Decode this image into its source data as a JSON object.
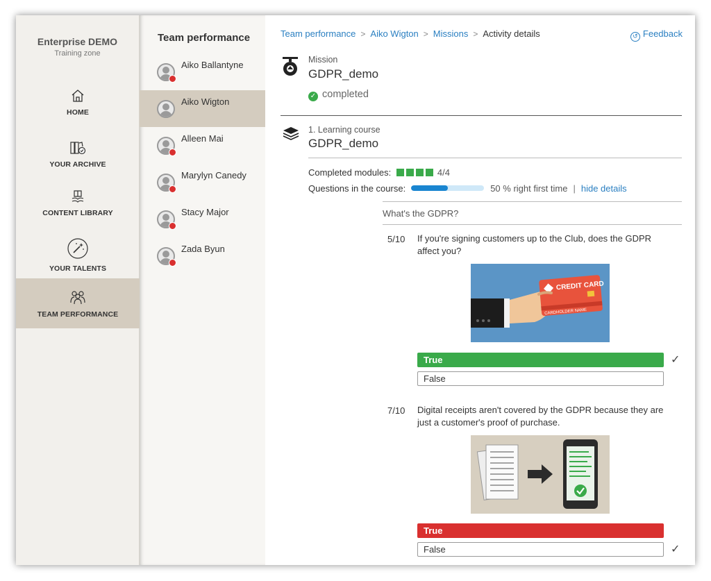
{
  "brand": {
    "title": "Enterprise DEMO",
    "subtitle": "Training zone"
  },
  "nav": [
    {
      "label": "HOME",
      "icon": "home-icon"
    },
    {
      "label": "YOUR ARCHIVE",
      "icon": "archive-icon"
    },
    {
      "label": "CONTENT LIBRARY",
      "icon": "library-icon"
    },
    {
      "label": "YOUR TALENTS",
      "icon": "talents-icon"
    },
    {
      "label": "TEAM PERFORMANCE",
      "icon": "team-icon",
      "active": true
    }
  ],
  "team": {
    "title": "Team performance",
    "members": [
      {
        "name": "Aiko Ballantyne"
      },
      {
        "name": "Aiko Wigton",
        "active": true
      },
      {
        "name": "Alleen Mai"
      },
      {
        "name": "Marylyn Canedy"
      },
      {
        "name": "Stacy Major"
      },
      {
        "name": "Zada Byun"
      }
    ]
  },
  "breadcrumb": {
    "items": [
      "Team performance",
      "Aiko Wigton",
      "Missions"
    ],
    "current": "Activity details"
  },
  "feedback_label": "Feedback",
  "mission": {
    "type": "Mission",
    "name": "GDPR_demo",
    "status": "completed"
  },
  "course": {
    "type": "1. Learning course",
    "name": "GDPR_demo",
    "modules_label": "Completed modules:",
    "modules_done": 4,
    "modules_total": 4,
    "modules_count": "4/4",
    "questions_label": "Questions in the course:",
    "questions_progress": 0.5,
    "questions_text": "50 % right first time",
    "hide_details": "hide details"
  },
  "section": {
    "title": "What's the GDPR?",
    "questions": [
      {
        "num": "5/10",
        "text": "If you're signing customers up to the          Club, does the GDPR affect you?",
        "image": "credit-card-illustration",
        "image_text": "CREDIT CARD",
        "image_subtext": "CARDHOLDER NAME",
        "answers": [
          {
            "label": "True",
            "style": "green",
            "checked": true
          },
          {
            "label": "False",
            "style": "plain",
            "checked": false
          }
        ]
      },
      {
        "num": "7/10",
        "text": "Digital receipts aren't covered by the GDPR because they are just a customer's proof of purchase.",
        "image": "paper-to-phone-receipt-illustration",
        "answers": [
          {
            "label": "True",
            "style": "red",
            "checked": false
          },
          {
            "label": "False",
            "style": "plain",
            "checked": true
          }
        ]
      }
    ]
  },
  "colors": {
    "accent": "#2a7fc1",
    "success": "#3aaa4a",
    "error": "#d9302f",
    "active_bg": "#d4ccbf"
  },
  "check_mark": "✓"
}
